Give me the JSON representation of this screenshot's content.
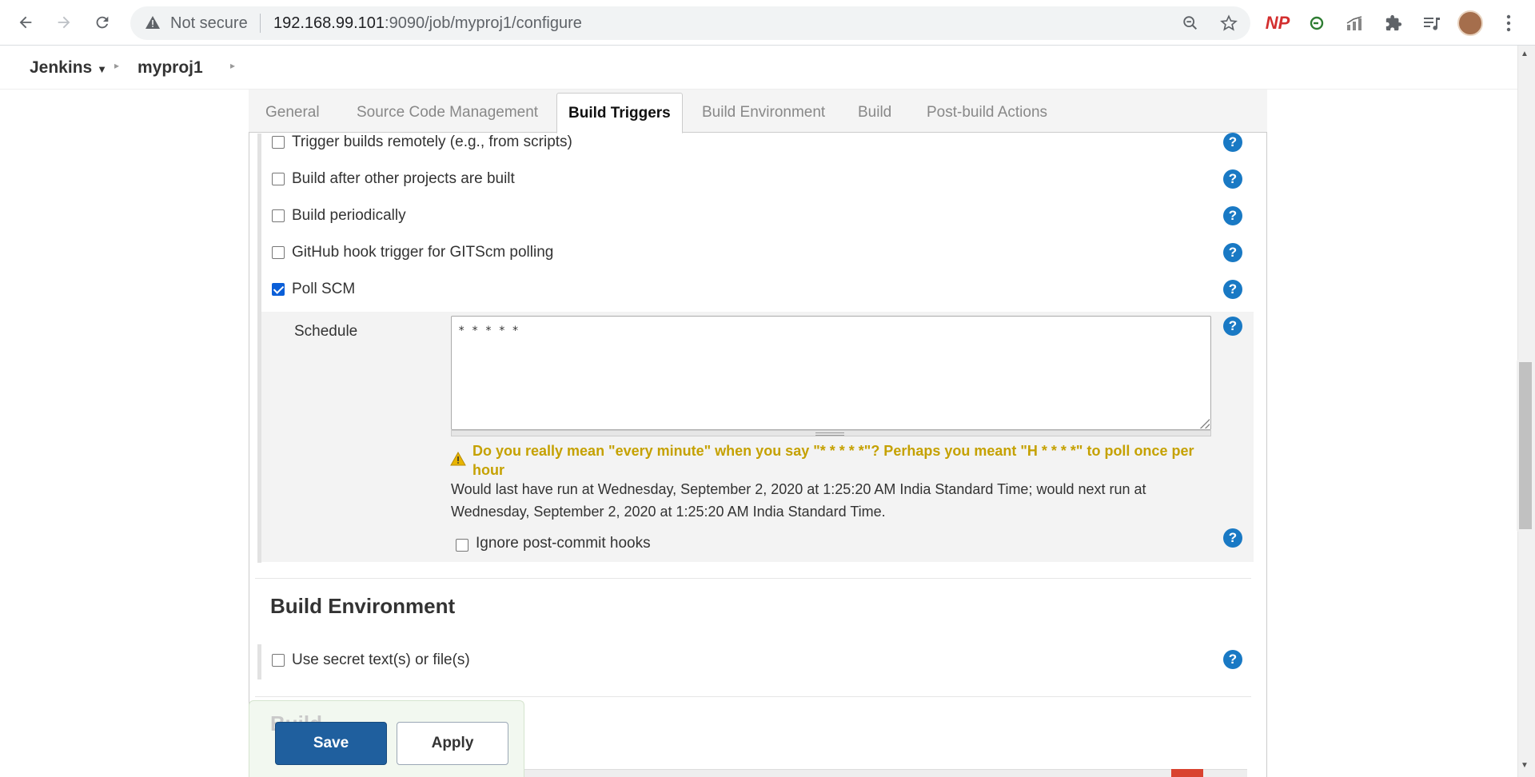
{
  "browser": {
    "security_label": "Not secure",
    "url_host": "192.168.99.101",
    "url_rest": ":9090/job/myproj1/configure",
    "extensions": [
      "NP",
      "grammar-icon",
      "chart-icon",
      "puzzle-icon",
      "media-icon"
    ]
  },
  "breadcrumb": {
    "root": "Jenkins",
    "project": "myproj1"
  },
  "tabs": [
    {
      "label": "General"
    },
    {
      "label": "Source Code Management"
    },
    {
      "label": "Build Triggers"
    },
    {
      "label": "Build Environment"
    },
    {
      "label": "Build"
    },
    {
      "label": "Post-build Actions"
    }
  ],
  "triggers": [
    {
      "label": "Trigger builds remotely (e.g., from scripts)",
      "checked": false
    },
    {
      "label": "Build after other projects are built",
      "checked": false
    },
    {
      "label": "Build periodically",
      "checked": false
    },
    {
      "label": "GitHub hook trigger for GITScm polling",
      "checked": false
    },
    {
      "label": "Poll SCM",
      "checked": true
    }
  ],
  "poll_scm": {
    "schedule_label": "Schedule",
    "schedule_value": "* * * * *",
    "warning": "Do you really mean \"every minute\" when you say \"* * * * *\"? Perhaps you meant \"H * * * *\" to poll once per hour",
    "info": "Would last have run at Wednesday, September 2, 2020 at 1:25:20 AM India Standard Time; would next run at Wednesday, September 2, 2020 at 1:25:20 AM India Standard Time.",
    "ignore_hooks_label": "Ignore post-commit hooks",
    "ignore_hooks_checked": false
  },
  "build_environment": {
    "heading": "Build Environment",
    "secret_label": "Use secret text(s) or file(s)",
    "secret_checked": false
  },
  "next_section_heading": "Build",
  "actions": {
    "save": "Save",
    "apply": "Apply"
  },
  "help_glyph": "?"
}
